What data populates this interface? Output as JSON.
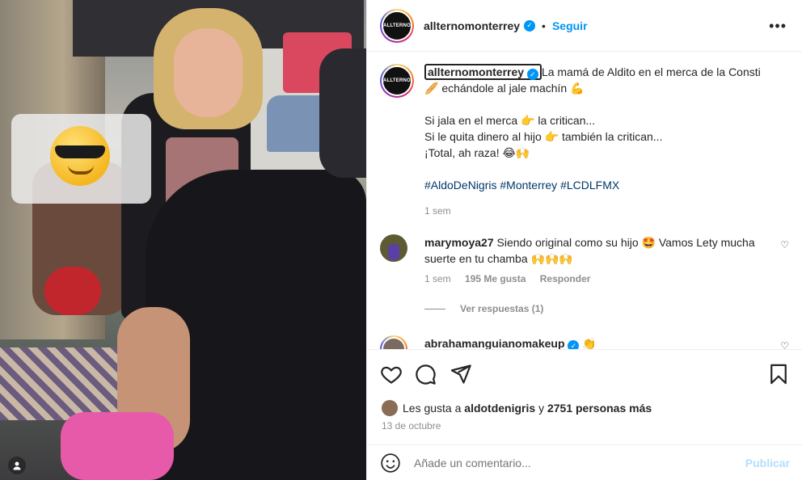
{
  "post": {
    "username": "allternomonterrey",
    "avatar_text": "ALLTERNO",
    "follow_label": "Seguir",
    "more_icon": "more-options-icon"
  },
  "caption": {
    "username": "allternomonterrey",
    "line1": "La mamá de Aldito en el merca de la Consti",
    "line2": "🥖 echándole al jale machín 💪",
    "line3": "Si jala en el merca 👉 la critican...",
    "line4": "Si le quita dinero al hijo 👉 también la critican...",
    "line5": "¡Total, ah raza! 😂🙌",
    "hashtags": [
      "#AldoDeNigris",
      "#Monterrey",
      "#LCDLFMX"
    ],
    "time": "1 sem"
  },
  "comments": [
    {
      "username": "marymoya27",
      "text": "Siendo original como su hijo 🤩 Vamos Lety mucha suerte en tu chamba 🙌🙌🙌",
      "time": "1 sem",
      "likes": "195 Me gusta",
      "reply_label": "Responder",
      "view_replies": "Ver respuestas (1)"
    },
    {
      "username": "abrahamanguianomakeup",
      "text": "👏"
    }
  ],
  "actions": {
    "like_icon": "heart-icon",
    "comment_icon": "comment-icon",
    "share_icon": "share-icon",
    "save_icon": "bookmark-icon"
  },
  "likes": {
    "prefix": "Les gusta a",
    "user": "aldotdenigris",
    "connector": "y",
    "others": "2751 personas más"
  },
  "date": "13 de octubre",
  "add_comment": {
    "placeholder": "Añade un comentario...",
    "post_label": "Publicar"
  },
  "colors": {
    "accent": "#0095f6",
    "hashtag": "#00376b",
    "muted": "#8e8e8e",
    "post_disabled": "#b2dffc"
  }
}
